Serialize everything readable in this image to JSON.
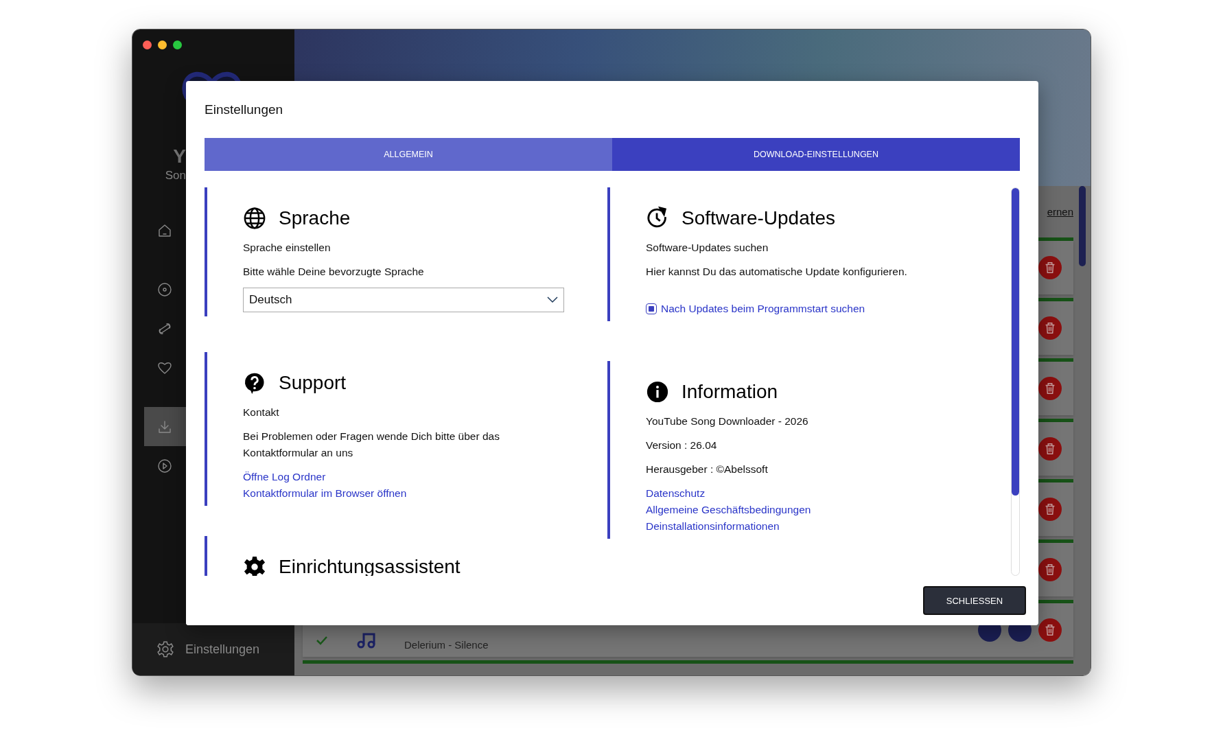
{
  "sidebar": {
    "brand_initial": "Y",
    "brand_sub": "Son",
    "nav_groups": [
      [
        {
          "selected": false
        }
      ],
      [
        {
          "selected": false
        },
        {
          "selected": false
        },
        {
          "selected": false
        }
      ],
      [
        {
          "selected": true
        },
        {
          "selected": false
        }
      ]
    ],
    "footer": {
      "label": "Einstellungen"
    }
  },
  "background": {
    "link": "ernen",
    "rows": [
      {
        "kind": "covered",
        "level": 1
      },
      {
        "kind": "covered",
        "level": 1
      },
      {
        "kind": "covered",
        "level": 1
      },
      {
        "kind": "covered",
        "level": 1
      },
      {
        "kind": "covered",
        "level": 1
      },
      {
        "kind": "covered",
        "level": 1
      },
      {
        "kind": "track",
        "title": "Delerium - Silence",
        "level": 1
      },
      {
        "kind": "edge",
        "level": 1
      }
    ]
  },
  "dialog": {
    "title": "Einstellungen",
    "tabs": [
      {
        "label": "ALLGEMEIN",
        "selected": true
      },
      {
        "label": "DOWNLOAD-EINSTELLUNGEN",
        "selected": false
      }
    ],
    "columns": [
      [
        {
          "title": "Sprache",
          "items": [
            {
              "kind": "text",
              "text": "Sprache einstellen"
            },
            {
              "kind": "text",
              "text": "Bitte wähle Deine bevorzugte Sprache"
            },
            {
              "kind": "select",
              "value": "Deutsch"
            }
          ]
        },
        {
          "title": "Support",
          "items": [
            {
              "kind": "text",
              "text": "Kontakt"
            },
            {
              "kind": "text",
              "text": "Bei Problemen oder Fragen wende Dich bitte über das Kontaktformular an uns"
            },
            {
              "kind": "link",
              "text": "Öffne Log Ordner"
            },
            {
              "kind": "link",
              "text": "Kontaktformular im Browser öffnen"
            }
          ]
        },
        {
          "title": "Einrichtungsassistent"
        }
      ],
      [
        {
          "title": "Software-Updates",
          "items": [
            {
              "kind": "text",
              "text": "Software-Updates suchen"
            },
            {
              "kind": "text",
              "text": "Hier kannst Du das automatische Update konfigurieren."
            },
            {
              "kind": "checkbox",
              "text": "Nach Updates beim Programmstart suchen",
              "checked": true
            }
          ]
        },
        {
          "title": "Information",
          "items": [
            {
              "kind": "text",
              "text": "YouTube Song Downloader - 2026"
            },
            {
              "kind": "text",
              "text": "Version : 26.04"
            },
            {
              "kind": "text",
              "text": "Herausgeber : ©Abelssoft"
            },
            {
              "kind": "link",
              "text": "Datenschutz"
            },
            {
              "kind": "link",
              "text": "Allgemeine Geschäftsbedingungen"
            },
            {
              "kind": "link",
              "text": "Deinstallationsinformationen"
            }
          ]
        }
      ]
    ],
    "close_button": "SCHLIESSEN"
  }
}
